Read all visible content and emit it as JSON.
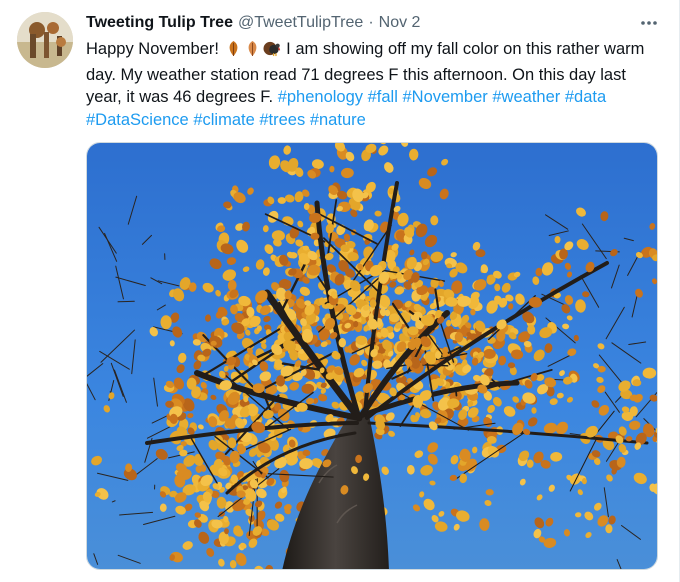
{
  "tweet": {
    "display_name": "Tweeting Tulip Tree",
    "handle": "@TweetTulipTree",
    "separator": "·",
    "date": "Nov 2",
    "more_icon": "more-horizontal-icon",
    "text": {
      "line1_a": "Happy November! ",
      "line1_emoji": [
        "fallen-leaf-emoji",
        "fallen-leaf-emoji",
        "turkey-emoji"
      ],
      "line1_b": " I am showing off my fall color on this rather warm",
      "line2": "day.  My weather station read 71 degrees F this afternoon. On this day last",
      "line3": "year, it was 46 degrees F. ",
      "line3_hashtags": [
        "#phenology",
        "#fall",
        "#November",
        "#weather",
        "#data"
      ],
      "line4_hashtags": [
        "#DataScience",
        "#climate",
        "#trees",
        "#nature"
      ]
    },
    "media": {
      "type": "photo",
      "subject": "tulip-tree-fall-canopy"
    }
  },
  "colors": {
    "text": "#0f1419",
    "secondary": "#536471",
    "link": "#1d9bf0",
    "sky": "#2f74d0",
    "leaf_gold": "#e0a22a",
    "leaf_orange": "#c9731c"
  }
}
